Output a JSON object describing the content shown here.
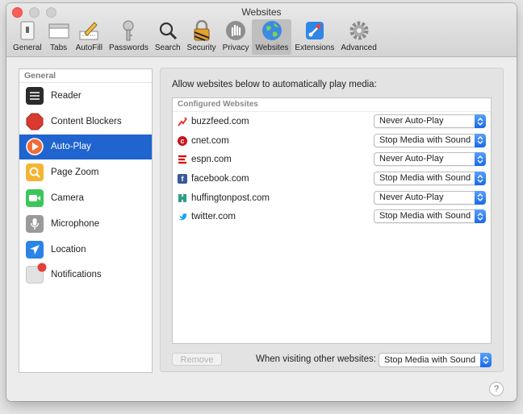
{
  "window": {
    "title": "Websites"
  },
  "toolbar": {
    "tabs": [
      {
        "label": "General",
        "icon": "general-icon"
      },
      {
        "label": "Tabs",
        "icon": "tabs-icon"
      },
      {
        "label": "AutoFill",
        "icon": "autofill-icon"
      },
      {
        "label": "Passwords",
        "icon": "key-icon"
      },
      {
        "label": "Search",
        "icon": "search-icon"
      },
      {
        "label": "Security",
        "icon": "lock-icon"
      },
      {
        "label": "Privacy",
        "icon": "hand-icon"
      },
      {
        "label": "Websites",
        "icon": "globe-icon"
      },
      {
        "label": "Extensions",
        "icon": "puzzle-icon"
      },
      {
        "label": "Advanced",
        "icon": "gear-icon"
      }
    ],
    "active": "Websites"
  },
  "sidebar": {
    "header": "General",
    "items": [
      {
        "label": "Reader",
        "icon": "reader-icon"
      },
      {
        "label": "Content Blockers",
        "icon": "stop-sign-icon"
      },
      {
        "label": "Auto-Play",
        "icon": "play-icon",
        "selected": true
      },
      {
        "label": "Page Zoom",
        "icon": "zoom-icon"
      },
      {
        "label": "Camera",
        "icon": "camera-icon"
      },
      {
        "label": "Microphone",
        "icon": "microphone-icon"
      },
      {
        "label": "Location",
        "icon": "location-arrow-icon"
      },
      {
        "label": "Notifications",
        "icon": "notifications-icon"
      }
    ]
  },
  "main": {
    "intro": "Allow websites below to automatically play media:",
    "list_header": "Configured Websites",
    "sites": [
      {
        "name": "buzzfeed.com",
        "setting": "Never Auto-Play",
        "favicon": "buzzfeed-favicon"
      },
      {
        "name": "cnet.com",
        "setting": "Stop Media with Sound",
        "favicon": "cnet-favicon"
      },
      {
        "name": "espn.com",
        "setting": "Never Auto-Play",
        "favicon": "espn-favicon"
      },
      {
        "name": "facebook.com",
        "setting": "Stop Media with Sound",
        "favicon": "facebook-favicon"
      },
      {
        "name": "huffingtonpost.com",
        "setting": "Never Auto-Play",
        "favicon": "huffingtonpost-favicon"
      },
      {
        "name": "twitter.com",
        "setting": "Stop Media with Sound",
        "favicon": "twitter-favicon"
      }
    ],
    "remove_label": "Remove",
    "other_label": "When visiting other websites:",
    "other_value": "Stop Media with Sound"
  },
  "help_label": "?",
  "colors": {
    "selection": "#1f64cf",
    "popup_arrow": "#1868e9"
  }
}
